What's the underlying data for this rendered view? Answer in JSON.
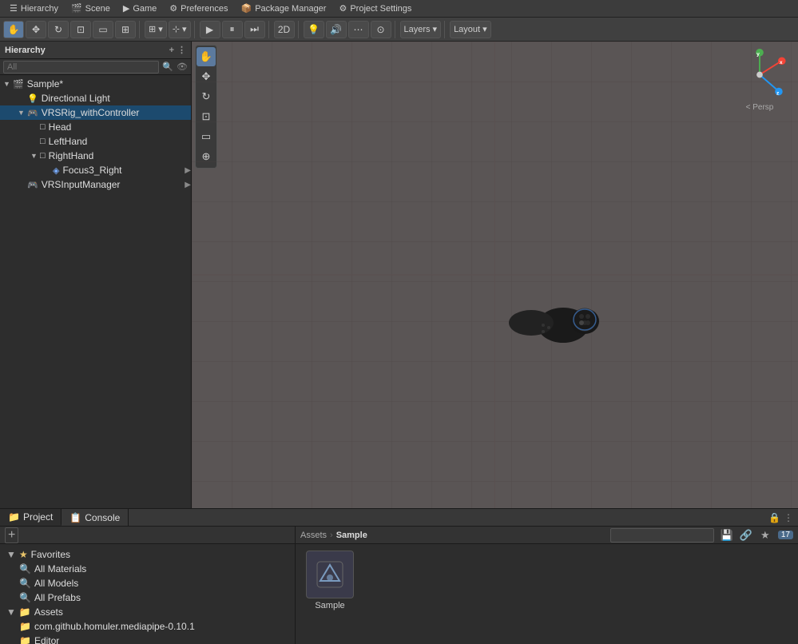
{
  "topMenu": {
    "tabs": [
      {
        "id": "hierarchy",
        "label": "Hierarchy",
        "icon": "☰"
      },
      {
        "id": "scene",
        "label": "Scene",
        "icon": "🎬"
      },
      {
        "id": "game",
        "label": "Game",
        "icon": "▶"
      },
      {
        "id": "preferences",
        "label": "Preferences",
        "icon": "⚙"
      },
      {
        "id": "packageManager",
        "label": "Package Manager",
        "icon": "📦"
      },
      {
        "id": "projectSettings",
        "label": "Project Settings",
        "icon": "⚙"
      }
    ]
  },
  "toolbar": {
    "transformTools": [
      "hand",
      "move",
      "rotate",
      "scale",
      "rect",
      "universal"
    ],
    "gridBtn": "⊞",
    "layersLabel": "Layers",
    "layoutLabel": "Layout",
    "viewBtn2D": "2D",
    "playBtn": "▶",
    "pauseBtn": "⏸",
    "stepBtn": "⏭"
  },
  "hierarchy": {
    "title": "Hierarchy",
    "searchPlaceholder": "All",
    "items": [
      {
        "id": "sample",
        "label": "Sample*",
        "indent": 0,
        "hasArrow": true,
        "expanded": true,
        "icon": "🎬",
        "isScene": true
      },
      {
        "id": "directionalLight",
        "label": "Directional Light",
        "indent": 1,
        "hasArrow": false,
        "icon": "💡"
      },
      {
        "id": "vrsRig",
        "label": "VRSRig_withController",
        "indent": 1,
        "hasArrow": true,
        "expanded": true,
        "icon": "🎮",
        "highlighted": true
      },
      {
        "id": "head",
        "label": "Head",
        "indent": 2,
        "hasArrow": false,
        "icon": "□"
      },
      {
        "id": "leftHand",
        "label": "LeftHand",
        "indent": 2,
        "hasArrow": false,
        "icon": "□"
      },
      {
        "id": "rightHand",
        "label": "RightHand",
        "indent": 2,
        "hasArrow": true,
        "expanded": true,
        "icon": "□"
      },
      {
        "id": "focus3Right",
        "label": "Focus3_Right",
        "indent": 3,
        "hasArrow": false,
        "icon": "◈"
      },
      {
        "id": "vrsInputManager",
        "label": "VRSInputManager",
        "indent": 1,
        "hasArrow": false,
        "icon": "🎮"
      }
    ]
  },
  "sceneView": {
    "perspLabel": "< Persp",
    "bgColor": "#6a6060"
  },
  "toolPalette": {
    "tools": [
      {
        "id": "hand",
        "icon": "✋",
        "active": true
      },
      {
        "id": "move",
        "icon": "✥"
      },
      {
        "id": "rotate",
        "icon": "↻"
      },
      {
        "id": "scale",
        "icon": "⊡"
      },
      {
        "id": "rect",
        "icon": "▭"
      },
      {
        "id": "world",
        "icon": "⊕"
      }
    ]
  },
  "bottomTabs": [
    {
      "id": "project",
      "label": "Project",
      "icon": "📁",
      "active": true
    },
    {
      "id": "console",
      "label": "Console",
      "icon": "📋",
      "active": false
    }
  ],
  "bottomLeft": {
    "addLabel": "+",
    "favorites": {
      "label": "Favorites",
      "items": [
        {
          "id": "allMaterials",
          "label": "All Materials",
          "icon": "🔍"
        },
        {
          "id": "allModels",
          "label": "All Models",
          "icon": "🔍"
        },
        {
          "id": "allPrefabs",
          "label": "All Prefabs",
          "icon": "🔍"
        }
      ]
    },
    "assets": {
      "label": "Assets",
      "items": [
        {
          "id": "comGithub",
          "label": "com.github.homuler.mediapipe-0.10.1",
          "icon": "📁"
        },
        {
          "id": "editor",
          "label": "Editor",
          "icon": "📁"
        }
      ]
    }
  },
  "bottomRight": {
    "breadcrumb": {
      "parts": [
        "Assets",
        "Sample"
      ]
    },
    "searchPlaceholder": "",
    "assetCount": "17",
    "assets": [
      {
        "id": "sample",
        "label": "Sample",
        "icon": "📦"
      }
    ]
  }
}
